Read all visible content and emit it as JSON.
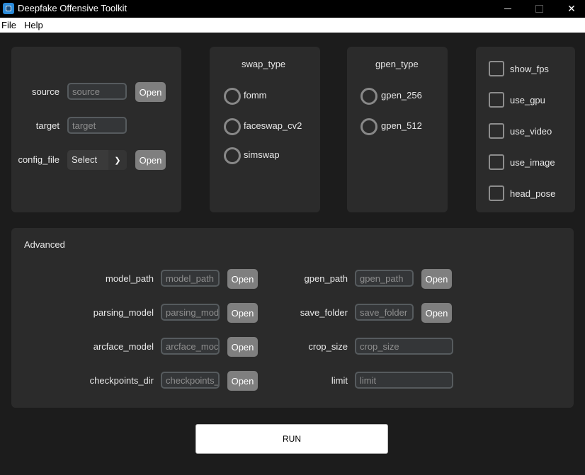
{
  "window": {
    "title": "Deepfake Offensive Toolkit",
    "minimize": "—",
    "maximize": "□",
    "close": "✕"
  },
  "menu": [
    "File",
    "Help"
  ],
  "io": {
    "source_label": "source",
    "source_placeholder": "source",
    "target_label": "target",
    "target_placeholder": "target",
    "config_label": "config_file",
    "config_selected": "Select",
    "open": "Open"
  },
  "swap_type": {
    "heading": "swap_type",
    "options": [
      "fomm",
      "faceswap_cv2",
      "simswap"
    ]
  },
  "gpen_type": {
    "heading": "gpen_type",
    "options": [
      "gpen_256",
      "gpen_512"
    ]
  },
  "flags": [
    "show_fps",
    "use_gpu",
    "use_video",
    "use_image",
    "head_pose"
  ],
  "advanced": {
    "heading": "Advanced",
    "left": [
      {
        "label": "model_path",
        "placeholder": "model_path",
        "button": "Open"
      },
      {
        "label": "parsing_model",
        "placeholder": "parsing_mod",
        "button": "Open"
      },
      {
        "label": "arcface_model",
        "placeholder": "arcface_moc",
        "button": "Open"
      },
      {
        "label": "checkpoints_dir",
        "placeholder": "checkpoints_",
        "button": "Open"
      }
    ],
    "right": [
      {
        "label": "gpen_path",
        "placeholder": "gpen_path",
        "button": "Open"
      },
      {
        "label": "save_folder",
        "placeholder": "save_folder",
        "button": "Open"
      },
      {
        "label": "crop_size",
        "placeholder": "crop_size"
      },
      {
        "label": "limit",
        "placeholder": "limit"
      }
    ]
  },
  "run": "RUN"
}
